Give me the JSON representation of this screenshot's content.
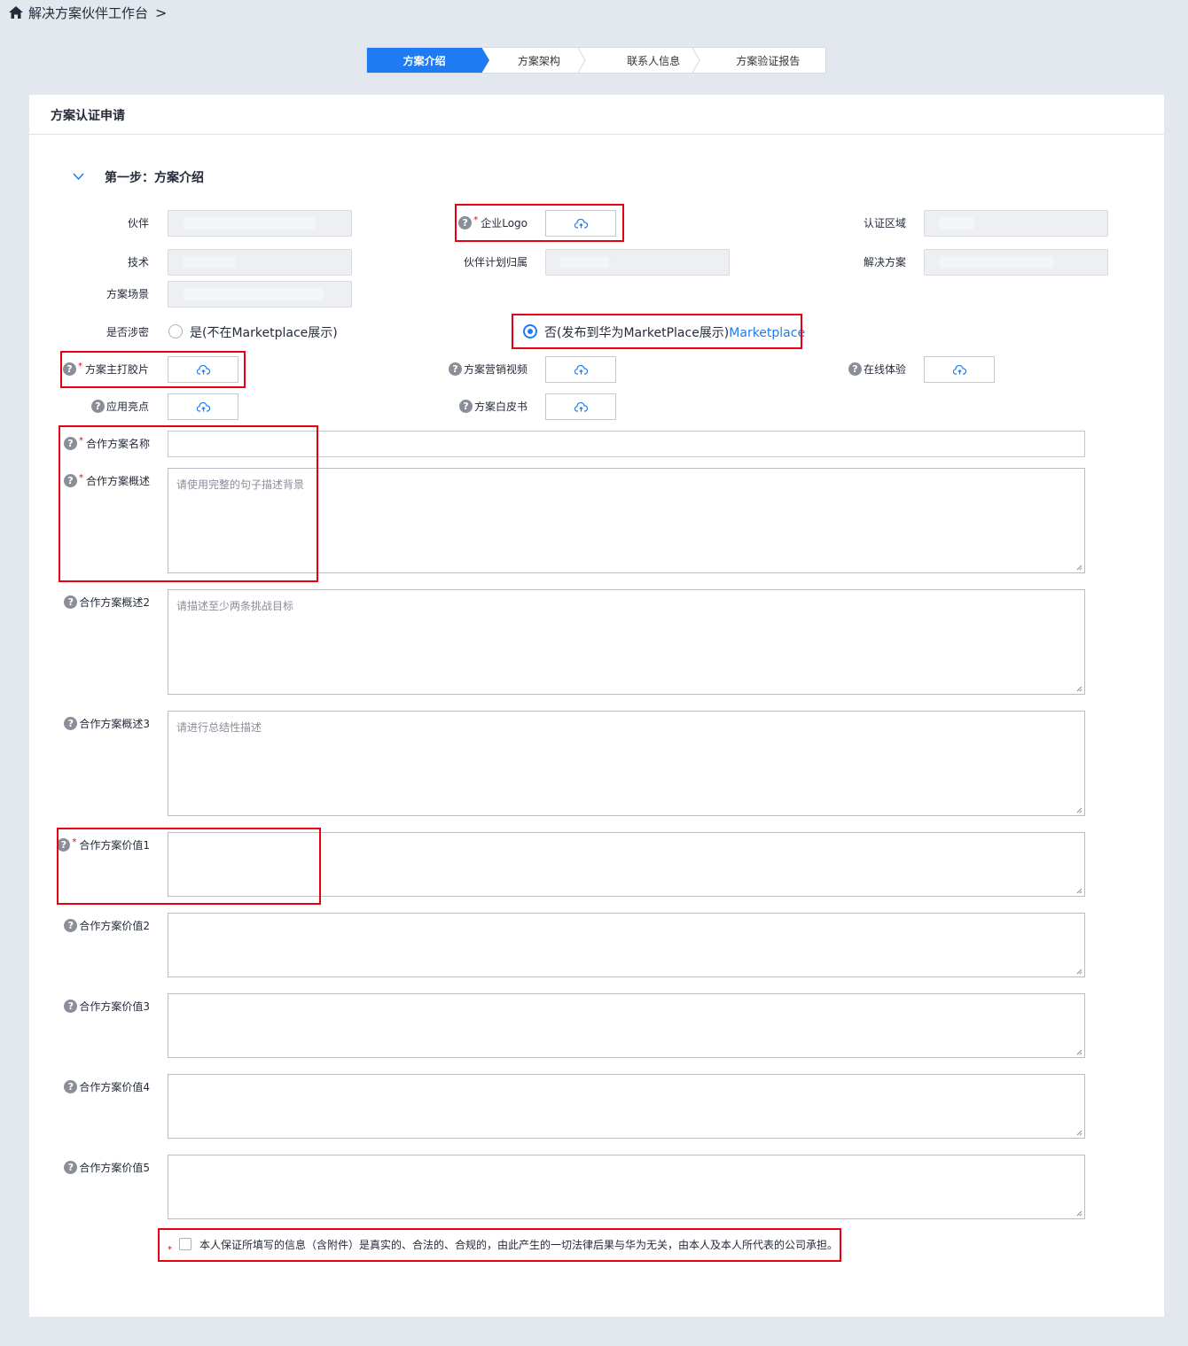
{
  "breadcrumb": {
    "home_icon": "home-icon",
    "title": "解决方案伙伴工作台",
    "separator": ">"
  },
  "stepper": {
    "steps": [
      "方案介绍",
      "方案架构",
      "联系人信息",
      "方案验证报告"
    ],
    "active_index": 0
  },
  "card": {
    "title": "方案认证申请"
  },
  "section": {
    "title": "第一步：方案介绍",
    "collapse_icon": "chevron-down-icon"
  },
  "fields": {
    "partner": {
      "label": "伙伴"
    },
    "logo": {
      "label": "企业Logo",
      "required": true
    },
    "region": {
      "label": "认证区域"
    },
    "tech": {
      "label": "技术"
    },
    "plan": {
      "label": "伙伴计划归属"
    },
    "solution": {
      "label": "解决方案"
    },
    "scenario": {
      "label": "方案场景"
    },
    "secret": {
      "label": "是否涉密",
      "option_yes": "是(不在Marketplace展示)",
      "option_no": "否(发布到华为MarketPlace展示)",
      "option_no_link": "Marketplace",
      "selected": "no"
    },
    "slide": {
      "label": "方案主打胶片",
      "required": true
    },
    "marketing_video": {
      "label": "方案营销视频"
    },
    "online_exp": {
      "label": "在线体验"
    },
    "highlights": {
      "label": "应用亮点"
    },
    "whitepaper": {
      "label": "方案白皮书"
    },
    "name": {
      "label": "合作方案名称",
      "required": true,
      "value": ""
    },
    "overview1": {
      "label": "合作方案概述",
      "required": true,
      "placeholder": "请使用完整的句子描述背景"
    },
    "overview2": {
      "label": "合作方案概述2",
      "placeholder": "请描述至少两条挑战目标"
    },
    "overview3": {
      "label": "合作方案概述3",
      "placeholder": "请进行总结性描述"
    },
    "value1": {
      "label": "合作方案价值1",
      "required": true
    },
    "value2": {
      "label": "合作方案价值2"
    },
    "value3": {
      "label": "合作方案价值3"
    },
    "value4": {
      "label": "合作方案价值4"
    },
    "value5": {
      "label": "合作方案价值5"
    }
  },
  "agreement": {
    "text": "本人保证所填写的信息（含附件）是真实的、合法的、合规的，由此产生的一切法律后果与华为无关，由本人及本人所代表的公司承担。",
    "required": true,
    "checked": false
  },
  "icons": {
    "help": "question-circle-icon",
    "upload": "cloud-upload-icon"
  },
  "colors": {
    "accent": "#1e7bf1",
    "required": "#e60012",
    "highlight_box": "#e60012",
    "background": "#e2e8ed"
  }
}
